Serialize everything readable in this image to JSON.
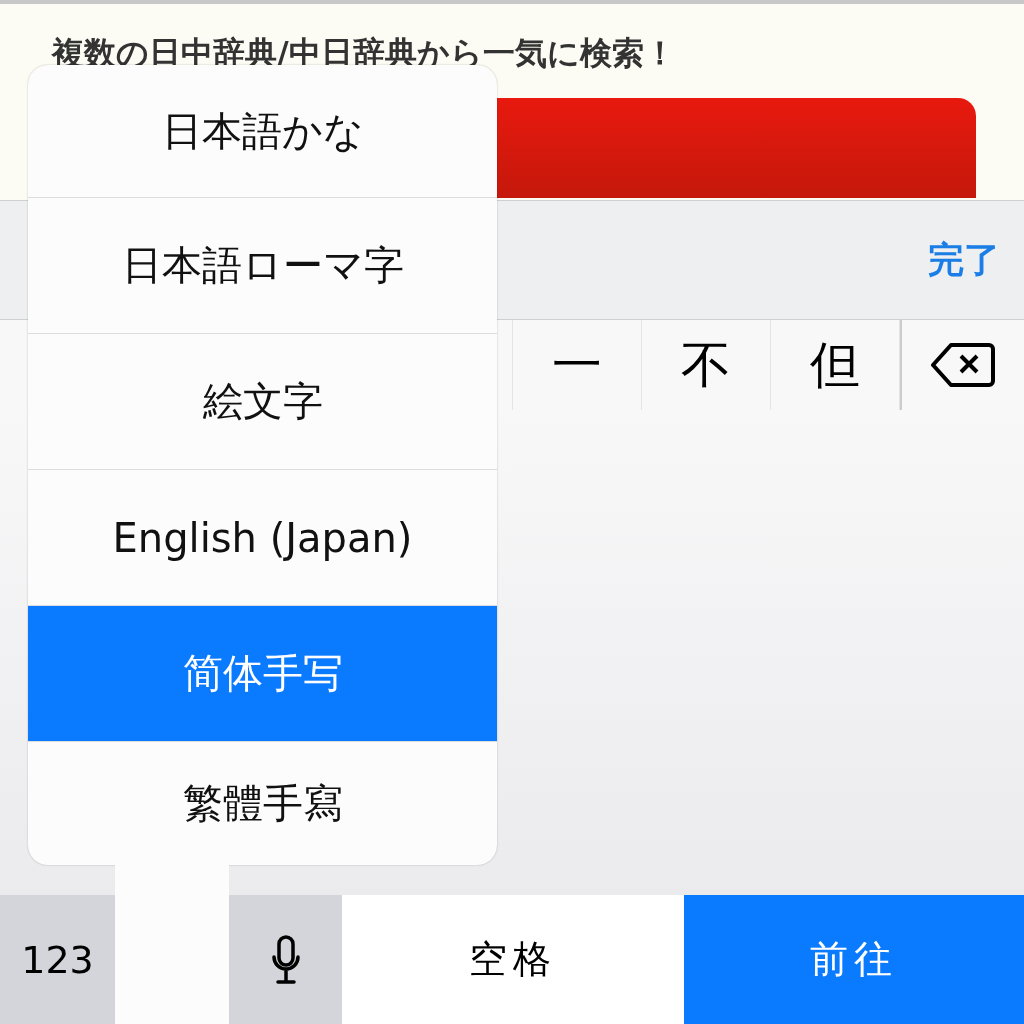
{
  "page": {
    "headline": "複数の日中辞典/中日辞典から一気に検索！"
  },
  "toolbar": {
    "done": "完了"
  },
  "candidates": [
    {
      "text": "一"
    },
    {
      "text": "不"
    },
    {
      "text": "但"
    }
  ],
  "bottom_keys": [
    {
      "kind": "numbers",
      "label": "123"
    },
    {
      "kind": "mic"
    },
    {
      "kind": "space",
      "label": "空格"
    },
    {
      "kind": "go",
      "label": "前往"
    }
  ],
  "keyboard_menu": [
    {
      "label": "日本語かな",
      "selected": false
    },
    {
      "label": "日本語ローマ字",
      "selected": false
    },
    {
      "label": "絵文字",
      "selected": false
    },
    {
      "label": "English (Japan)",
      "selected": false
    },
    {
      "label": "简体手写",
      "selected": true
    },
    {
      "label": "繁體手寫",
      "selected": false
    }
  ]
}
